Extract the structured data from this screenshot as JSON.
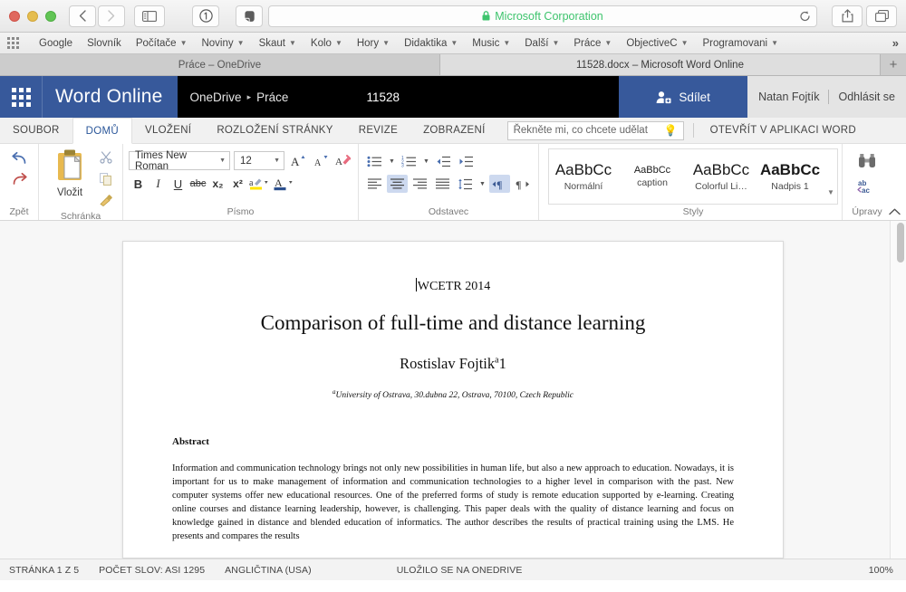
{
  "browser": {
    "window_controls": [
      "close",
      "minimize",
      "maximize"
    ],
    "nav": {
      "back": "‹",
      "forward": "›",
      "sidebar": "sidebar-icon"
    },
    "extensions": [
      "1password-icon",
      "evernote-icon"
    ],
    "address": {
      "value": "Microsoft Corporation",
      "secure": true,
      "lock": "lock-icon",
      "reload": "reload-icon"
    },
    "actions": {
      "share": "share-icon",
      "tabs": "show-tabs-icon"
    },
    "bookmarks": [
      {
        "label": "Google",
        "has_menu": false
      },
      {
        "label": "Slovník",
        "has_menu": false
      },
      {
        "label": "Počítače",
        "has_menu": true
      },
      {
        "label": "Noviny",
        "has_menu": true
      },
      {
        "label": "Skaut",
        "has_menu": true
      },
      {
        "label": "Kolo",
        "has_menu": true
      },
      {
        "label": "Hory",
        "has_menu": true
      },
      {
        "label": "Didaktika",
        "has_menu": true
      },
      {
        "label": "Music",
        "has_menu": true
      },
      {
        "label": "Další",
        "has_menu": true
      },
      {
        "label": "Práce",
        "has_menu": true
      },
      {
        "label": "ObjectiveC",
        "has_menu": true
      },
      {
        "label": "Programovani",
        "has_menu": true
      }
    ],
    "bookmarks_overflow": "»",
    "tabs": [
      {
        "label": "Práce – OneDrive",
        "active": false
      },
      {
        "label": "11528.docx – Microsoft Word Online",
        "active": true
      }
    ],
    "new_tab": "+"
  },
  "app_header": {
    "waffle": "app-launcher-icon",
    "brand": "Word Online",
    "breadcrumb": {
      "root": "OneDrive",
      "separator": "▸",
      "folder": "Práce"
    },
    "document_name": "11528",
    "share_button": "Sdílet",
    "share_icon": "person-add-icon",
    "user_name": "Natan Fojtík",
    "signout": "Odhlásit se",
    "colors": {
      "accent_blue": "#37599b",
      "header_black": "#000000",
      "account_bg": "#e4e4e4"
    }
  },
  "ribbon_tabs": {
    "tabs": [
      {
        "label": "SOUBOR",
        "active": false
      },
      {
        "label": "DOMŮ",
        "active": true
      },
      {
        "label": "VLOŽENÍ",
        "active": false
      },
      {
        "label": "ROZLOŽENÍ STRÁNKY",
        "active": false
      },
      {
        "label": "REVIZE",
        "active": false
      },
      {
        "label": "ZOBRAZENÍ",
        "active": false
      }
    ],
    "tell_me_placeholder": "Řekněte mi, co chcete udělat",
    "tell_me_icon": "lightbulb-icon",
    "open_in_word": "OTEVŘÍT V APLIKACI WORD"
  },
  "ribbon": {
    "groups": [
      {
        "label": "Zpět"
      },
      {
        "label": "Schránka"
      },
      {
        "label": "Písmo"
      },
      {
        "label": "Odstavec"
      },
      {
        "label": "Styly"
      },
      {
        "label": "Úpravy"
      }
    ],
    "undo": {
      "undo_icon": "undo-icon",
      "redo_icon": "redo-icon"
    },
    "clipboard": {
      "paste_label": "Vložit",
      "paste_icon": "paste-icon",
      "cut_icon": "scissors-icon",
      "copy_icon": "copy-icon",
      "format_painter_icon": "format-painter-icon"
    },
    "font": {
      "family_value": "Times New Roman",
      "size_value": "12",
      "grow_icon": "grow-font-icon",
      "shrink_icon": "shrink-font-icon",
      "clear_format_icon": "clear-formatting-icon",
      "bold": "B",
      "italic": "I",
      "underline": "U",
      "strikethrough": "abc",
      "subscript": "x₂",
      "superscript": "x²",
      "highlight_icon": "highlight-color-icon",
      "font_color_icon": "font-color-icon"
    },
    "paragraph": {
      "bullets_icon": "bullet-list-icon",
      "numbering_icon": "numbered-list-icon",
      "decrease_indent_icon": "decrease-indent-icon",
      "increase_indent_icon": "increase-indent-icon",
      "align_left_icon": "align-left-icon",
      "align_center_icon": "align-center-icon",
      "align_right_icon": "align-right-icon",
      "align_justify_icon": "align-justify-icon",
      "line_spacing_icon": "line-spacing-icon",
      "ltr_icon": "text-direction-ltr-icon",
      "rtl_icon": "text-direction-rtl-icon",
      "active": [
        "align-center-icon",
        "text-direction-ltr-icon"
      ]
    },
    "styles": [
      {
        "preview": "AaBbCc",
        "name": "Normální",
        "size": "17px",
        "weight": "400"
      },
      {
        "preview": "AaBbCc",
        "name": "caption",
        "size": "11px",
        "weight": "400"
      },
      {
        "preview": "AaBbCc",
        "name": "Colorful Li…",
        "size": "17px",
        "weight": "400"
      },
      {
        "preview": "AaBbCc",
        "name": "Nadpis 1",
        "size": "17px",
        "weight": "700"
      }
    ],
    "styles_more_icon": "styles-more-icon",
    "editing": {
      "find_icon": "binoculars-find-icon",
      "replace_icon": "replace-icon"
    },
    "collapse_icon": "collapse-ribbon-icon"
  },
  "document": {
    "conference": "WCETR 2014",
    "title": "Comparison of full-time and distance learning",
    "author": "Rostislav Fojtik",
    "author_sup": "a",
    "author_note": "1",
    "affiliation_sup": "a",
    "affiliation": "University of Ostrava, 30.dubna 22, Ostrava, 70100, Czech Republic",
    "abstract_heading": "Abstract",
    "abstract_text": "Information and communication technology brings not only new possibilities in human life, but also a new approach to education. Nowadays, it is important for us to make management of information and communication technologies to a higher level in comparison with the past. New computer systems offer new educational resources. One of the preferred forms of study is remote education supported by e-learning. Creating online courses and distance learning leadership, however, is challenging. This paper deals with the quality of distance learning and focus on knowledge gained in distance and blended education of informatics. The author describes the results of practical training using the LMS. He presents and compares the results"
  },
  "status_bar": {
    "page": "STRÁNKA 1 Z 5",
    "word_count": "POČET SLOV: ASI 1295",
    "language": "ANGLIČTINA (USA)",
    "save_state": "ULOŽILO SE NA ONEDRIVE",
    "zoom": "100%"
  }
}
